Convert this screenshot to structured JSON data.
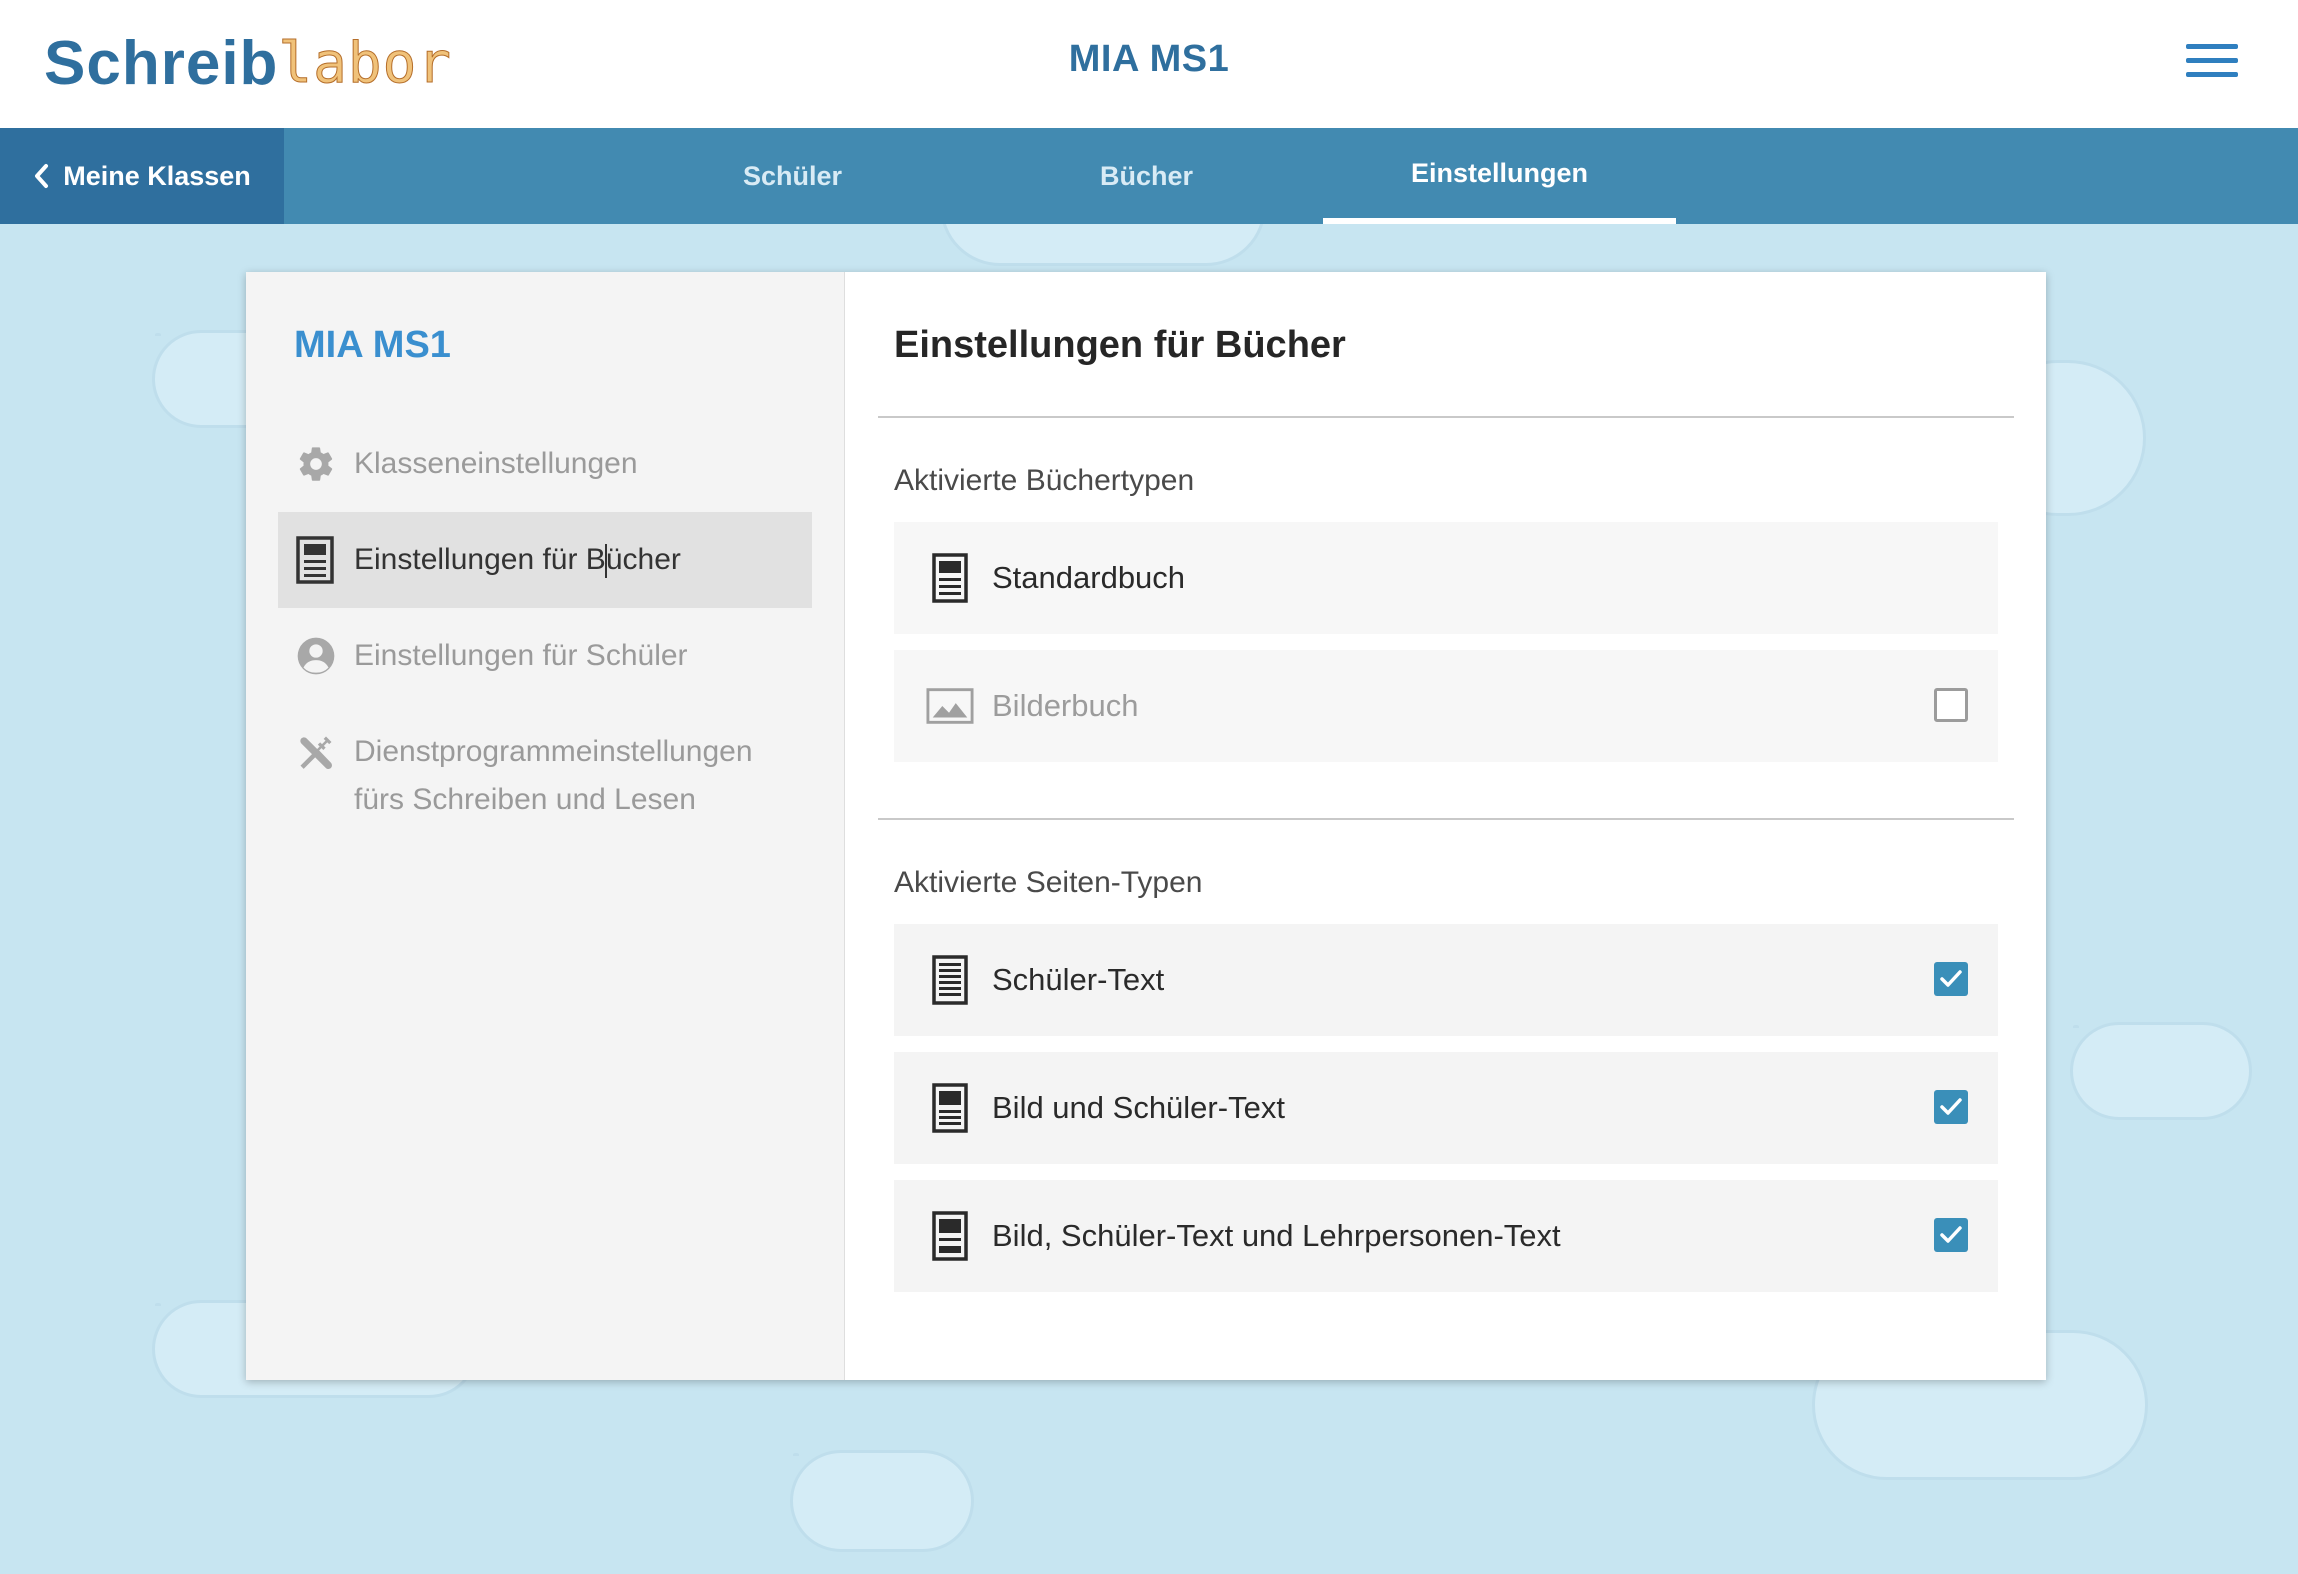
{
  "header": {
    "logo_part1": "Schreib",
    "logo_part2": "labor",
    "title": "MIA MS1"
  },
  "navbar": {
    "back_label": "Meine Klassen",
    "tabs": [
      {
        "label": "Schüler",
        "active": false
      },
      {
        "label": "Bücher",
        "active": false
      },
      {
        "label": "Einstellungen",
        "active": true
      }
    ]
  },
  "sidebar": {
    "title": "MIA MS1",
    "items": [
      {
        "label": "Klasseneinstellungen",
        "icon": "gear-icon",
        "active": false
      },
      {
        "label_pre": "Einstellungen für B",
        "label_post": "ücher",
        "icon": "book-icon",
        "active": true
      },
      {
        "label": "Einstellungen für Schüler",
        "icon": "user-icon",
        "active": false
      },
      {
        "label_line1": "Dienstprogrammeinstellungen",
        "label_line2": "fürs Schreiben und Lesen",
        "icon": "tools-icon",
        "active": false
      }
    ]
  },
  "content": {
    "title": "Einstellungen für Bücher",
    "book_types": {
      "label": "Aktivierte Büchertypen",
      "items": [
        {
          "label": "Standardbuch",
          "icon": "standard-book-icon",
          "checkbox": "none"
        },
        {
          "label": "Bilderbuch",
          "icon": "image-icon",
          "checkbox": "unchecked"
        }
      ]
    },
    "page_types": {
      "label": "Aktivierte Seiten-Typen",
      "items": [
        {
          "label": "Schüler-Text",
          "icon": "text-page-icon",
          "checkbox": "checked"
        },
        {
          "label": "Bild und Schüler-Text",
          "icon": "image-text-page-icon",
          "checkbox": "checked"
        },
        {
          "label": "Bild, Schüler-Text und Lehrpersonen-Text",
          "icon": "image-text-teacher-page-icon",
          "checkbox": "checked"
        }
      ]
    }
  },
  "colors": {
    "background": "#c7e5f1",
    "nav_bar": "#428ab1",
    "nav_back": "#2f6f9e",
    "accent": "#3a8fcf",
    "checkbox": "#3a8fb9"
  }
}
